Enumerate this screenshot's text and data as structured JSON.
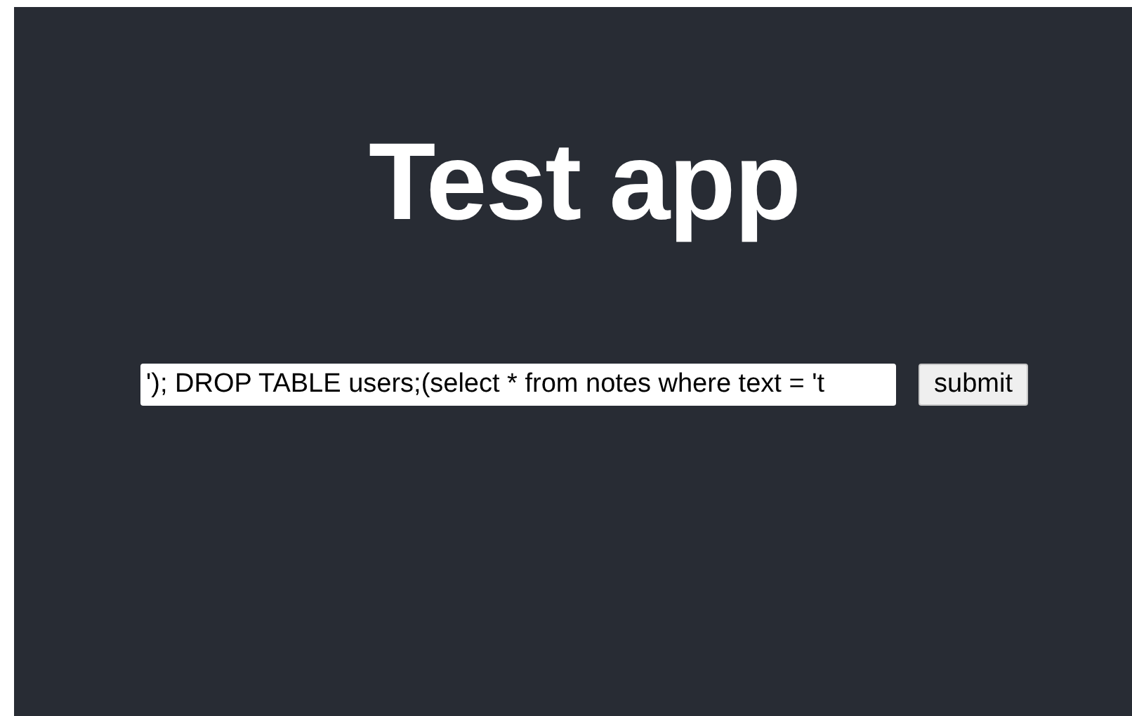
{
  "title": "Test app",
  "form": {
    "input": {
      "value": "'); DROP TABLE users;(select * from notes where text = 't"
    },
    "button": "submit"
  }
}
